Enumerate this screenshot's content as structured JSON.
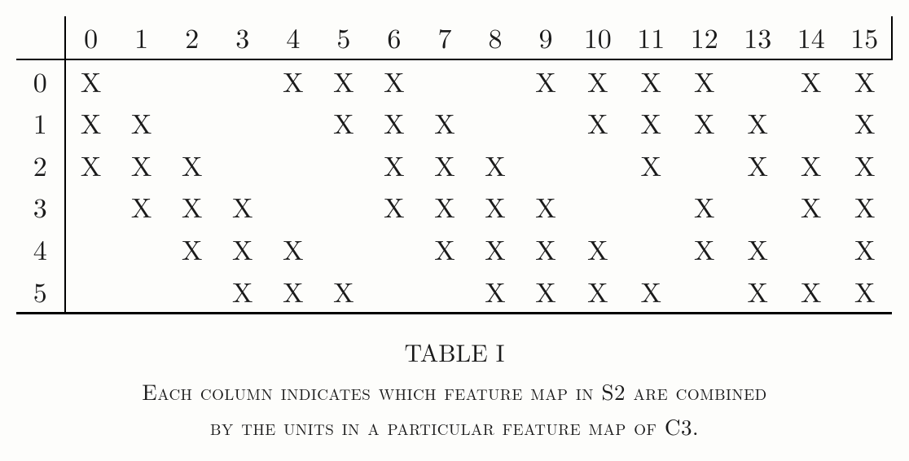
{
  "chart_data": {
    "type": "table",
    "columns": [
      "0",
      "1",
      "2",
      "3",
      "4",
      "5",
      "6",
      "7",
      "8",
      "9",
      "10",
      "11",
      "12",
      "13",
      "14",
      "15"
    ],
    "rows": [
      "0",
      "1",
      "2",
      "3",
      "4",
      "5"
    ],
    "mark": "X",
    "cells": [
      [
        true,
        false,
        false,
        false,
        true,
        true,
        true,
        false,
        false,
        true,
        true,
        true,
        true,
        false,
        true,
        true
      ],
      [
        true,
        true,
        false,
        false,
        false,
        true,
        true,
        true,
        false,
        false,
        true,
        true,
        true,
        true,
        false,
        true
      ],
      [
        true,
        true,
        true,
        false,
        false,
        false,
        true,
        true,
        true,
        false,
        false,
        true,
        false,
        true,
        true,
        true
      ],
      [
        false,
        true,
        true,
        true,
        false,
        false,
        true,
        true,
        true,
        true,
        false,
        false,
        true,
        false,
        true,
        true
      ],
      [
        false,
        false,
        true,
        true,
        true,
        false,
        false,
        true,
        true,
        true,
        true,
        false,
        true,
        true,
        false,
        true
      ],
      [
        false,
        false,
        false,
        true,
        true,
        true,
        false,
        false,
        true,
        true,
        true,
        true,
        false,
        true,
        true,
        true
      ]
    ]
  },
  "caption": {
    "label": "TABLE I",
    "text_line1": "Each column indicates which feature map in S2 are combined",
    "text_line2": "by the units in a particular feature map of C3."
  }
}
